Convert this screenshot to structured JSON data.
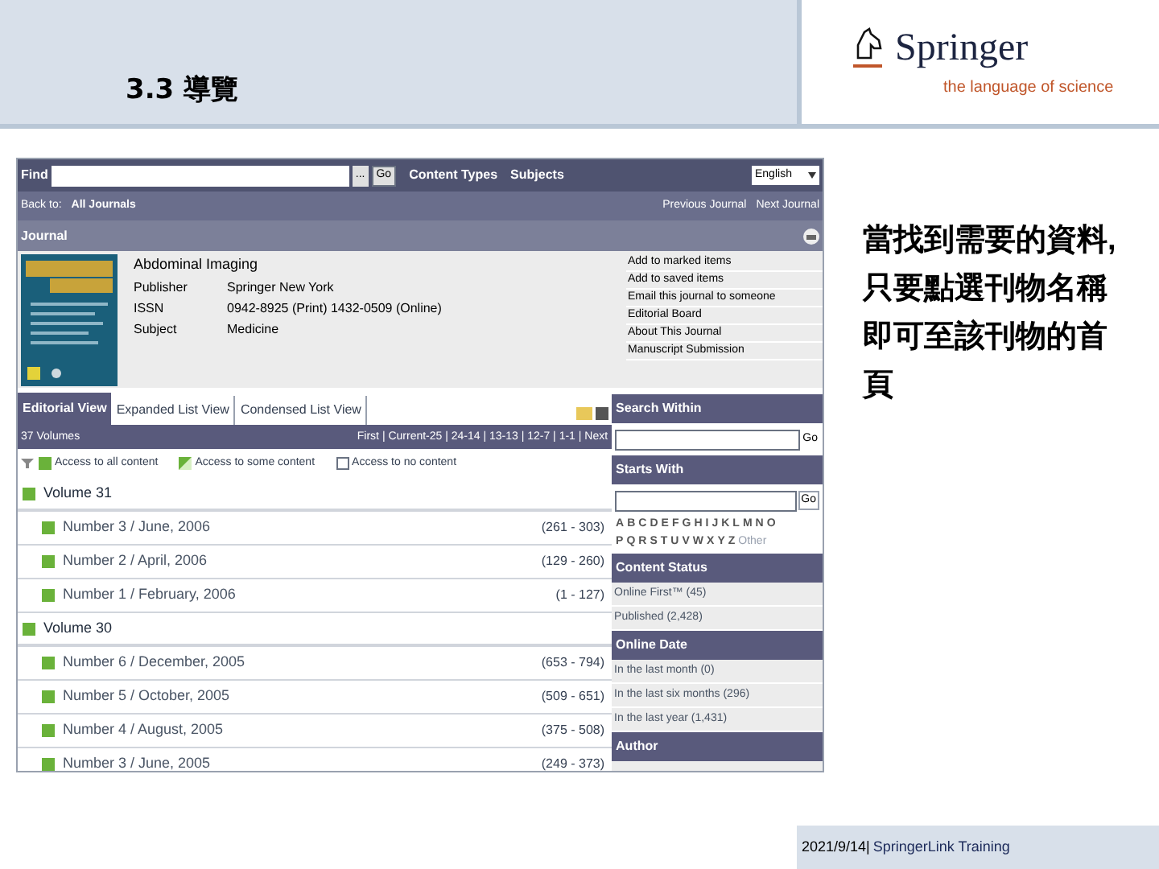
{
  "slide": {
    "title": "3.3 導覽",
    "logo": {
      "name": "Springer",
      "tagline": "the language of science"
    },
    "note": "當找到需要的資料,只要點選刊物名稱即可至該刊物的首頁",
    "footer": {
      "date": "2021/9/14|",
      "text": "SpringerLink Training"
    }
  },
  "site": {
    "topbar": {
      "find_label": "Find",
      "more": "...",
      "go": "Go",
      "links": [
        "Content Types",
        "Subjects"
      ],
      "language": "English"
    },
    "nav": {
      "back_label": "Back to:",
      "back_link": "All Journals",
      "links": [
        "Previous Journal",
        "Next Journal"
      ]
    },
    "section_title": "Journal",
    "journal": {
      "title": "Abdominal Imaging",
      "fields": [
        {
          "label": "Publisher",
          "value": "Springer New York"
        },
        {
          "label": "ISSN",
          "value": "0942-8925 (Print) 1432-0509 (Online)"
        },
        {
          "label": "Subject",
          "value": "Medicine"
        }
      ],
      "actions": [
        "Add to marked items",
        "Add to saved items",
        "Email this journal to someone",
        "Editorial Board",
        "About This Journal",
        "Manuscript Submission"
      ]
    },
    "tabs": [
      {
        "label": "Editorial View",
        "selected": true
      },
      {
        "label": "Expanded List View",
        "selected": false
      },
      {
        "label": "Condensed List View",
        "selected": false
      }
    ],
    "volumes_header": {
      "count": "37 Volumes",
      "pager": "First | Current-25 | 24-14 | 13-13 | 12-7 | 1-1 | Next"
    },
    "legend": [
      {
        "kind": "full",
        "label": "Access to all content"
      },
      {
        "kind": "some",
        "label": "Access to some content"
      },
      {
        "kind": "none",
        "label": "Access to no content"
      }
    ],
    "issues": [
      {
        "kind": "volume",
        "label": "Volume 31"
      },
      {
        "kind": "issue",
        "label": "Number 3 / June, 2006",
        "pages": "(261 - 303)"
      },
      {
        "kind": "issue",
        "label": "Number 2 / April, 2006",
        "pages": "(129 - 260)"
      },
      {
        "kind": "issue",
        "label": "Number 1 / February, 2006",
        "pages": "(1 - 127)"
      },
      {
        "kind": "volume",
        "label": "Volume 30"
      },
      {
        "kind": "issue",
        "label": "Number 6 / December, 2005",
        "pages": "(653 - 794)"
      },
      {
        "kind": "issue",
        "label": "Number 5 / October, 2005",
        "pages": "(509 - 651)"
      },
      {
        "kind": "issue",
        "label": "Number 4 / August, 2005",
        "pages": "(375 - 508)"
      },
      {
        "kind": "issue",
        "label": "Number 3 / June, 2005",
        "pages": "(249 - 373)"
      }
    ],
    "sidebar": {
      "search_within": {
        "title": "Search Within",
        "go": "Go"
      },
      "starts_with": {
        "title": "Starts With",
        "go": "Go",
        "letter_rows": [
          [
            "A",
            "B",
            "C",
            "D",
            "E",
            "F",
            "G",
            "H",
            "I",
            "J",
            "K",
            "L",
            "M",
            "N",
            "O"
          ],
          [
            "P",
            "Q",
            "R",
            "S",
            "T",
            "U",
            "V",
            "W",
            "X",
            "Y",
            "Z"
          ]
        ],
        "other": "Other"
      },
      "content_status": {
        "title": "Content Status",
        "items": [
          "Online First™ (45)",
          "Published (2,428)"
        ]
      },
      "online_date": {
        "title": "Online Date",
        "items": [
          "In the last month (0)",
          "In the last six months (296)",
          "In the last year (1,431)"
        ]
      },
      "author": {
        "title": "Author"
      }
    }
  }
}
